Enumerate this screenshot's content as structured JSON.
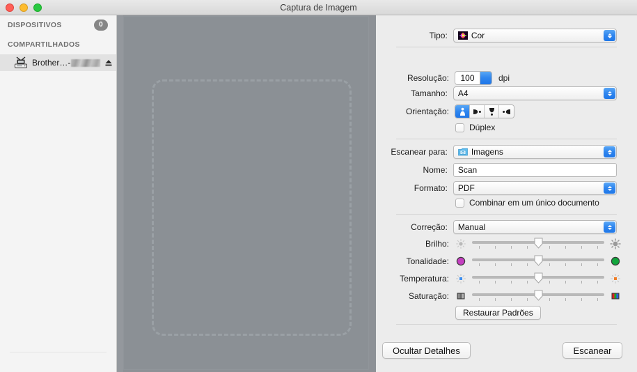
{
  "window": {
    "title": "Captura de Imagem",
    "traffic_lights": [
      "close",
      "minimize",
      "zoom"
    ]
  },
  "sidebar": {
    "sections": [
      {
        "label": "DISPOSITIVOS",
        "badge": "0"
      },
      {
        "label": "COMPARTILHADOS",
        "badge": null
      }
    ],
    "device": {
      "label": "Brother…-",
      "redacted": true,
      "selected": true,
      "eject": "eject-icon"
    }
  },
  "preview": {
    "background_color": "#8d9196",
    "marquee": {
      "style": "dashed",
      "color": "#9aa0a5"
    }
  },
  "panel": {
    "tipo": {
      "label": "Tipo:",
      "value": "Cor",
      "icon": "color-photo-icon"
    },
    "resolucao": {
      "label": "Resolução:",
      "value": "100",
      "unit": "dpi"
    },
    "tamanho": {
      "label": "Tamanho:",
      "value": "A4"
    },
    "orientacao": {
      "label": "Orientação:",
      "options": [
        "portrait-up",
        "landscape-right",
        "portrait-down",
        "landscape-left"
      ],
      "selected_index": 0
    },
    "duplex": {
      "label": "Dúplex",
      "checked": false
    },
    "escanear_para": {
      "label": "Escanear para:",
      "value": "Imagens",
      "icon": "pictures-folder-icon"
    },
    "nome": {
      "label": "Nome:",
      "value": "Scan"
    },
    "formato": {
      "label": "Formato:",
      "value": "PDF"
    },
    "combinar": {
      "label": "Combinar em um único documento",
      "checked": false
    },
    "correcao": {
      "label": "Correção:",
      "value": "Manual"
    },
    "sliders": [
      {
        "label": "Brilho:",
        "value": 50,
        "left_icon": "brightness-low-icon",
        "right_icon": "brightness-high-icon"
      },
      {
        "label": "Tonalidade:",
        "value": 50,
        "left_icon": "tint-magenta-icon",
        "right_icon": "tint-green-icon"
      },
      {
        "label": "Temperatura:",
        "value": 50,
        "left_icon": "temperature-cool-icon",
        "right_icon": "temperature-warm-icon"
      },
      {
        "label": "Saturação:",
        "value": 50,
        "left_icon": "saturation-gray-icon",
        "right_icon": "saturation-color-icon"
      }
    ],
    "restaurar": "Restaurar Padrões",
    "ocultar_detalhes": "Ocultar Detalhes",
    "escanear": "Escanear"
  }
}
